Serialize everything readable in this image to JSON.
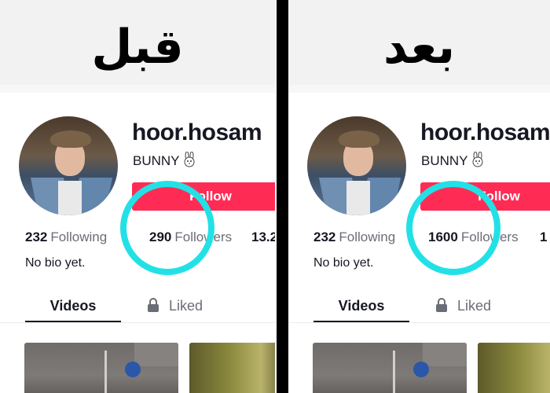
{
  "labels": {
    "before": "قبل",
    "after": "بعد"
  },
  "profile": {
    "username": "hoor.hosam",
    "nickname": "BUNNY",
    "follow_button": "Follow",
    "bio": "No bio yet."
  },
  "before": {
    "following_count": "232",
    "following_label": "Following",
    "followers_count": "290",
    "followers_label": "Followers",
    "likes_count": "13.2"
  },
  "after": {
    "following_count": "232",
    "following_label": "Following",
    "followers_count": "1600",
    "followers_label": "Followers",
    "likes_count": "1"
  },
  "tabs": [
    {
      "label": "Videos",
      "selected": true
    },
    {
      "label": "Liked",
      "icon": "lock-icon"
    }
  ],
  "icons": {
    "nickname_emoji": "bunny-icon",
    "liked_tab": "lock-icon"
  },
  "colors": {
    "follow_button": "#fe2c55",
    "highlight_ring": "#22e1e6",
    "divider": "#000000",
    "secondary_text": "#6b6d76"
  }
}
